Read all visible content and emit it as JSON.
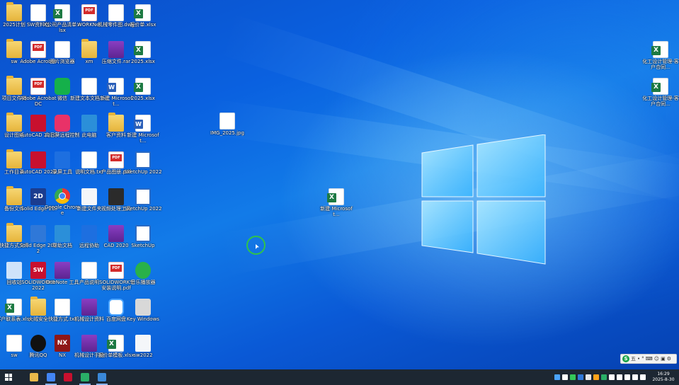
{
  "desktop": {
    "icons": [
      {
        "id": "r1c1",
        "label": "2025计划",
        "kind": "folder"
      },
      {
        "id": "r1c2",
        "label": "SW资料包",
        "kind": "file"
      },
      {
        "id": "r1c3",
        "label": "X公司产品清单.xlsx",
        "kind": "xlsx"
      },
      {
        "id": "r1c4",
        "label": "WORKNet",
        "kind": "pdf"
      },
      {
        "id": "r1c5",
        "label": "机械零件图.dwg",
        "kind": "file"
      },
      {
        "id": "r1c6",
        "label": "报价单.xlsx",
        "kind": "xlsx"
      },
      {
        "id": "r2c1",
        "label": "sw",
        "kind": "folder"
      },
      {
        "id": "r2c2",
        "label": "Adobe Acrobat",
        "kind": "pdf"
      },
      {
        "id": "r2c3",
        "label": "图片浏览器",
        "kind": "file"
      },
      {
        "id": "r2c4",
        "label": "xm",
        "kind": "folder"
      },
      {
        "id": "r2c5",
        "label": "压缩文件.rar",
        "kind": "winrar"
      },
      {
        "id": "r2c6",
        "label": "2025.xlsx",
        "kind": "xlsx"
      },
      {
        "id": "r3c1",
        "label": "项目文件夹",
        "kind": "folder"
      },
      {
        "id": "r3c2",
        "label": "Adobe Acrobat DC",
        "kind": "pdf"
      },
      {
        "id": "r3c3",
        "label": "微信",
        "kind": "green"
      },
      {
        "id": "r3c4",
        "label": "新建文本文档.txt",
        "kind": "file"
      },
      {
        "id": "r3c5",
        "label": "新建 Microsoft...",
        "kind": "docx"
      },
      {
        "id": "r3c6",
        "label": "2025.xlsx",
        "kind": "xlsx"
      },
      {
        "id": "r4c1",
        "label": "设计图纸",
        "kind": "folder"
      },
      {
        "id": "r4c2",
        "label": "AutoCAD 2020",
        "kind": "red"
      },
      {
        "id": "r4c3",
        "label": "向日葵远程控制",
        "kind": "pink"
      },
      {
        "id": "r4c4",
        "label": "此电脑",
        "kind": "tool"
      },
      {
        "id": "r4c5",
        "label": "客户资料",
        "kind": "folder"
      },
      {
        "id": "r4c6",
        "label": "新建 Microsoft...",
        "kind": "docx"
      },
      {
        "id": "r5c1",
        "label": "工作目录",
        "kind": "folder"
      },
      {
        "id": "r5c2",
        "label": "AutoCAD 2020",
        "kind": "red"
      },
      {
        "id": "r5c3",
        "label": "录屏工具",
        "kind": "blue"
      },
      {
        "id": "r5c4",
        "label": "说明文档.txt",
        "kind": "file"
      },
      {
        "id": "r5c5",
        "label": "产品图册.pdf",
        "kind": "pdf"
      },
      {
        "id": "r5c6",
        "label": "SketchUp 2022",
        "kind": "sdk"
      },
      {
        "id": "r6c1",
        "label": "备份文件",
        "kind": "folder"
      },
      {
        "id": "r6c2",
        "label": "Solid Edge 2D",
        "kind": "navy",
        "glyph": "2D"
      },
      {
        "id": "r6c3",
        "label": "Google Chrome",
        "kind": "chrome"
      },
      {
        "id": "r6c4",
        "label": "新建文件夹",
        "kind": "white"
      },
      {
        "id": "r6c5",
        "label": "视频处理工具",
        "kind": "dark"
      },
      {
        "id": "r6c6",
        "label": "SketchUp 2022",
        "kind": "sdk"
      },
      {
        "id": "r7c1",
        "label": "快捷方式文件",
        "kind": "folder"
      },
      {
        "id": "r7c2",
        "label": "Solid Edge 2022",
        "kind": "teal"
      },
      {
        "id": "r7c3",
        "label": "帮助文档",
        "kind": "tool"
      },
      {
        "id": "r7c4",
        "label": "远程协助",
        "kind": "blue"
      },
      {
        "id": "r7c5",
        "label": "CAD 2020",
        "kind": "winrar"
      },
      {
        "id": "r7c6",
        "label": "SketchUp",
        "kind": "sdk"
      },
      {
        "id": "r8c1",
        "label": "回收站",
        "kind": "recycle"
      },
      {
        "id": "r8c2",
        "label": "SOLIDWORKS 2022",
        "kind": "sw",
        "glyph": "SW"
      },
      {
        "id": "r8c3",
        "label": "OneNote 工具",
        "kind": "winrar"
      },
      {
        "id": "r8c4",
        "label": "产品说明",
        "kind": "file"
      },
      {
        "id": "r8c5",
        "label": "SOLIDWORKS 安装说明.pdf",
        "kind": "pdf"
      },
      {
        "id": "r8c6",
        "label": "音乐播放器",
        "kind": "music"
      },
      {
        "id": "r9c1",
        "label": "客户联系表.xlsx",
        "kind": "xlsx"
      },
      {
        "id": "r9c2",
        "label": "火绒安全",
        "kind": "folder"
      },
      {
        "id": "r9c3",
        "label": "快捷方式.txt",
        "kind": "file"
      },
      {
        "id": "r9c4",
        "label": "机械设计资料",
        "kind": "winrar"
      },
      {
        "id": "r9c5",
        "label": "百度网盘",
        "kind": "cloud"
      },
      {
        "id": "r9c6",
        "label": "Key Windows",
        "kind": "usb"
      },
      {
        "id": "r10c1",
        "label": "sw",
        "kind": "file"
      },
      {
        "id": "r10c2",
        "label": "腾讯QQ",
        "kind": "qq"
      },
      {
        "id": "r10c3",
        "label": "NX",
        "kind": "nx",
        "glyph": "NX"
      },
      {
        "id": "r10c4",
        "label": "机械设计手册",
        "kind": "winrar"
      },
      {
        "id": "r10c5",
        "label": "报价单模板.xlsx",
        "kind": "xlsx"
      },
      {
        "id": "r10c6",
        "label": "sw2022",
        "kind": "white"
      },
      {
        "id": "mid1",
        "label": "IMG_2025.jpg",
        "kind": "file"
      },
      {
        "id": "mid2",
        "label": "新建 Microsoft...",
        "kind": "xlsx"
      },
      {
        "id": "right1",
        "label": "化工设计管理-客户合同...",
        "kind": "xlsx"
      },
      {
        "id": "right2",
        "label": "化工设计管理-客户合同...",
        "kind": "xlsx"
      }
    ]
  },
  "ime": {
    "brand": "S",
    "labels": [
      "五",
      "•",
      "°",
      "⌨",
      "☺",
      "▣",
      "⚙"
    ]
  },
  "taskbar": {
    "apps": [
      {
        "name": "file-explorer",
        "color": "#e8b84a",
        "active": false
      },
      {
        "name": "chrome",
        "color": "#4285f4",
        "active": true
      },
      {
        "name": "recorder",
        "color": "#c8102e",
        "active": false
      },
      {
        "name": "wechat",
        "color": "#2aae67",
        "active": true
      },
      {
        "name": "media-player",
        "color": "#3a88d8",
        "active": true
      }
    ],
    "tray_colors": [
      "#4aa3ff",
      "#ffffff",
      "#34c759",
      "#2f78d8",
      "#e8e8e8",
      "#ffa31a",
      "#2aae67",
      "#ffffff",
      "#ffffff",
      "#ffffff",
      "#ffffff",
      "#ffffff"
    ],
    "clock": {
      "time": "16:29",
      "date": "2025-8-30"
    }
  }
}
